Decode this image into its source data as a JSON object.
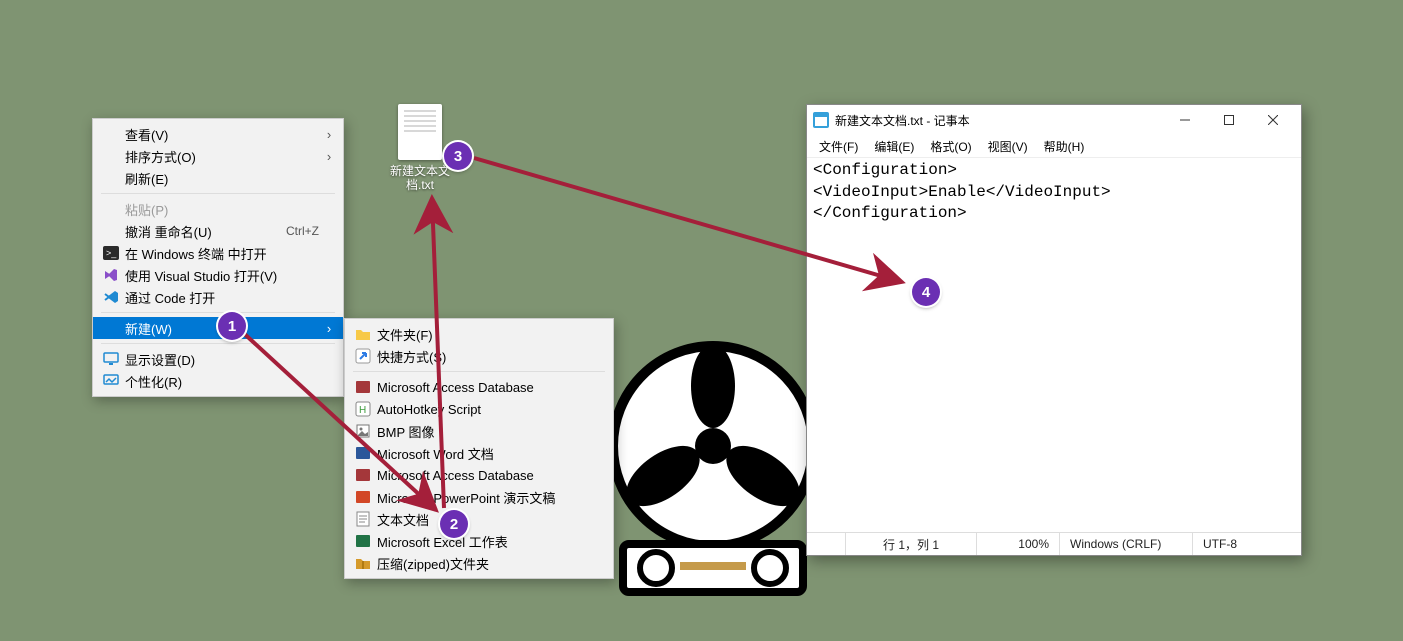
{
  "desktop_file": {
    "name": "新建文本文\n档.txt"
  },
  "context_main": {
    "items": [
      {
        "label": "查看(V)",
        "arrow": true
      },
      {
        "label": "排序方式(O)",
        "arrow": true
      },
      {
        "label": "刷新(E)"
      },
      {
        "sep": true
      },
      {
        "label": "粘贴(P)",
        "disabled": true
      },
      {
        "label": "撤消 重命名(U)",
        "shortcut": "Ctrl+Z"
      },
      {
        "icon": "terminal-icon",
        "label": "在 Windows 终端 中打开"
      },
      {
        "icon": "visualstudio-icon",
        "label": "使用 Visual Studio 打开(V)"
      },
      {
        "icon": "vscode-icon",
        "label": "通过 Code 打开"
      },
      {
        "sep": true
      },
      {
        "label": "新建(W)",
        "arrow": true,
        "highlight": true
      },
      {
        "sep": true
      },
      {
        "icon": "display-icon",
        "label": "显示设置(D)"
      },
      {
        "icon": "personalize-icon",
        "label": "个性化(R)"
      }
    ]
  },
  "context_new": {
    "items": [
      {
        "icon": "folder-icon",
        "label": "文件夹(F)"
      },
      {
        "icon": "shortcut-icon",
        "label": "快捷方式(S)"
      },
      {
        "sep": true
      },
      {
        "icon": "access-icon",
        "label": "Microsoft Access Database"
      },
      {
        "icon": "ahk-icon",
        "label": "AutoHotkey Script"
      },
      {
        "icon": "bmp-icon",
        "label": "BMP 图像"
      },
      {
        "icon": "word-icon",
        "label": "Microsoft Word 文档"
      },
      {
        "icon": "access-icon",
        "label": "Microsoft Access Database"
      },
      {
        "icon": "ppt-icon",
        "label": "Microsoft PowerPoint 演示文稿"
      },
      {
        "icon": "txt-icon",
        "label": "文本文档"
      },
      {
        "icon": "excel-icon",
        "label": "Microsoft Excel 工作表"
      },
      {
        "icon": "zip-icon",
        "label": "压缩(zipped)文件夹"
      }
    ]
  },
  "notepad": {
    "title": "新建文本文档.txt - 记事本",
    "menu": [
      "文件(F)",
      "编辑(E)",
      "格式(O)",
      "视图(V)",
      "帮助(H)"
    ],
    "content": "<Configuration>\n<VideoInput>Enable</VideoInput>\n</Configuration>",
    "status": {
      "pos": "行 1，列 1",
      "zoom": "100%",
      "eol": "Windows (CRLF)",
      "enc": "UTF-8"
    }
  },
  "bubbles": {
    "b1": "1",
    "b2": "2",
    "b3": "3",
    "b4": "4"
  },
  "icon_color": {
    "terminal": "#2b2b2b",
    "vs": "#8a4fc9",
    "code": "#1f8ad2",
    "display": "#1f8ad2",
    "personalize": "#1f8ad2",
    "folder": "#f7c948",
    "shortcut": "#2c7be5",
    "access": "#a4373a",
    "ahk": "#3a9a3a",
    "bmp": "#777",
    "word": "#2b579a",
    "ppt": "#d24726",
    "txt": "#888",
    "excel": "#217346",
    "zip": "#d59a2b",
    "notepad": "#35a0da"
  }
}
